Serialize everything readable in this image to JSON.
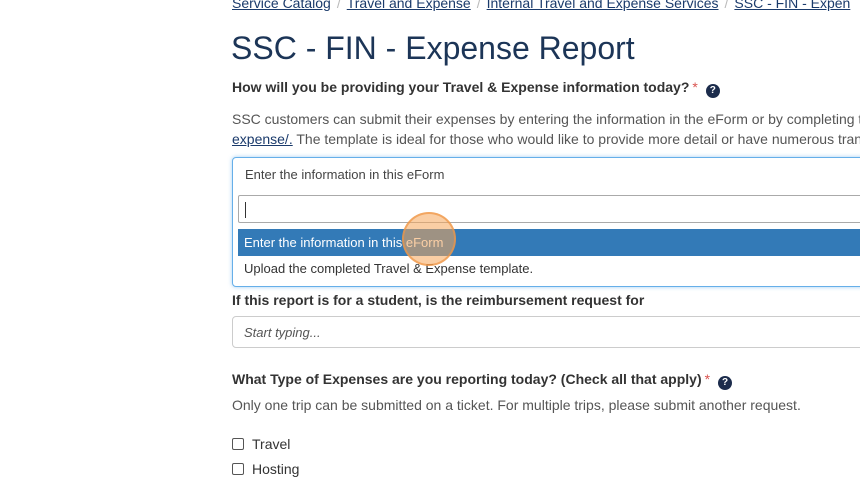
{
  "breadcrumb": {
    "items": [
      "Service Catalog",
      "Travel and Expense",
      "Internal Travel and Expense Services",
      "SSC - FIN - Expen"
    ]
  },
  "page_title": "SSC - FIN - Expense Report",
  "question_provide": {
    "label": "How will you be providing your Travel & Expense information today?",
    "required": "*",
    "help": "?"
  },
  "description": {
    "line1": "SSC customers can submit their expenses by entering the information in the eForm or by completing t",
    "link": "expense/.",
    "line2_rest": " The template is ideal for those who would like to provide more detail or have numerous tran"
  },
  "select": {
    "current_value": "Enter the information in this eForm",
    "search_value": "",
    "options": [
      "Enter the information in this eForm",
      "Upload the completed Travel & Expense template."
    ]
  },
  "question_student": {
    "label": "If this report is for a student, is the reimbursement request for",
    "placeholder": "Start typing..."
  },
  "question_types": {
    "label": "What Type of Expenses are you reporting today? (Check all that apply)",
    "required": "*",
    "help": "?",
    "help_text": "Only one trip can be submitted on a ticket. For multiple trips, please submit another request.",
    "options": [
      "Travel",
      "Hosting"
    ]
  },
  "colors": {
    "title": "#1c3557",
    "highlight": "#337ab7",
    "required": "#d9534f",
    "focus_border": "#66afe9"
  }
}
